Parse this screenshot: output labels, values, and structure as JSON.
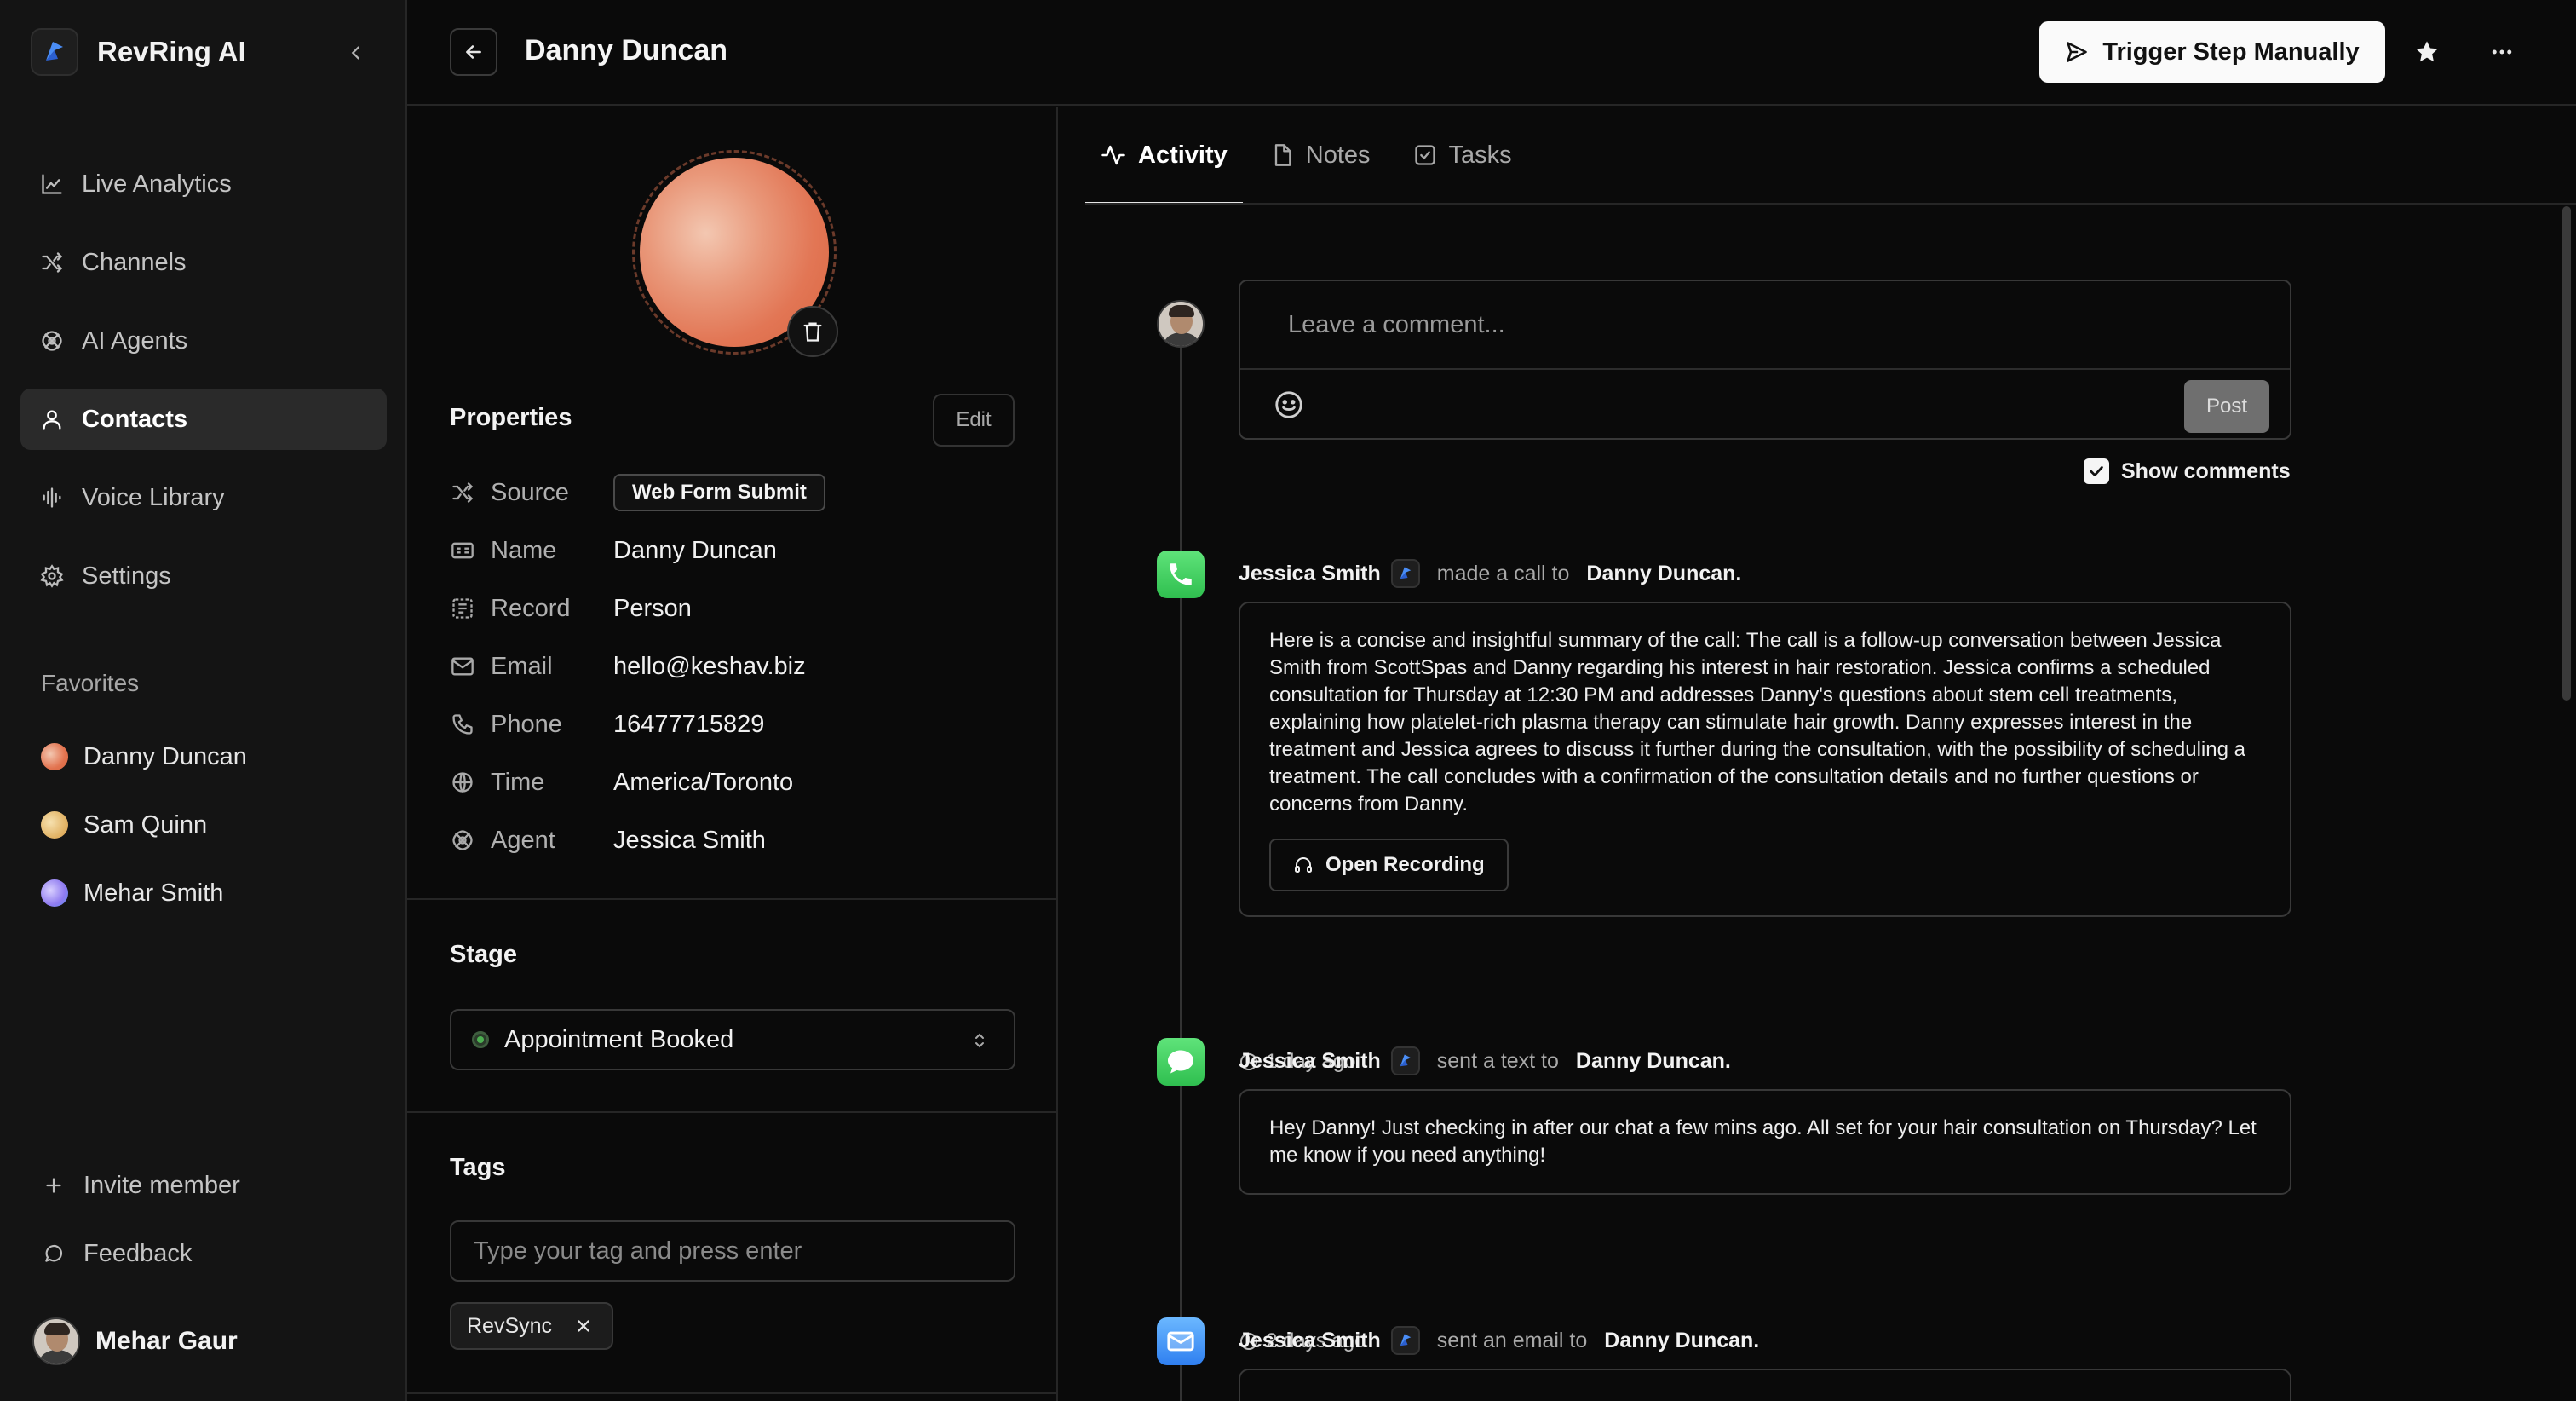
{
  "app": {
    "name": "RevRing AI"
  },
  "sidebar": {
    "nav": [
      {
        "label": "Live Analytics",
        "icon": "chart-icon"
      },
      {
        "label": "Channels",
        "icon": "shuffle-icon"
      },
      {
        "label": "AI Agents",
        "icon": "agent-icon"
      },
      {
        "label": "Contacts",
        "icon": "user-icon",
        "active": true
      },
      {
        "label": "Voice Library",
        "icon": "waveform-icon"
      },
      {
        "label": "Settings",
        "icon": "gear-icon"
      }
    ],
    "favorites_title": "Favorites",
    "favorites": [
      {
        "name": "Danny Duncan",
        "color": "#e2734f"
      },
      {
        "name": "Sam Quinn",
        "color": "#e3b66a"
      },
      {
        "name": "Mehar Smith",
        "color": "#8f7bf0"
      }
    ],
    "invite_label": "Invite member",
    "feedback_label": "Feedback",
    "user_name": "Mehar Gaur"
  },
  "header": {
    "title": "Danny Duncan",
    "trigger_label": "Trigger Step Manually"
  },
  "contact": {
    "properties_title": "Properties",
    "edit_label": "Edit",
    "properties": [
      {
        "label": "Source",
        "value": "Web Form Submit",
        "icon": "shuffle-icon"
      },
      {
        "label": "Name",
        "value": "Danny Duncan",
        "icon": "id-card-icon"
      },
      {
        "label": "Record",
        "value": "Person",
        "icon": "record-icon"
      },
      {
        "label": "Email",
        "value": "hello@keshav.biz",
        "icon": "mail-icon"
      },
      {
        "label": "Phone",
        "value": "16477715829",
        "icon": "phone-icon"
      },
      {
        "label": "Time",
        "value": "America/Toronto",
        "icon": "globe-icon"
      },
      {
        "label": "Agent",
        "value": "Jessica Smith",
        "icon": "agent-icon"
      }
    ],
    "stage_title": "Stage",
    "stage_value": "Appointment Booked",
    "tags_title": "Tags",
    "tag_placeholder": "Type your tag and press enter",
    "tags": [
      "RevSync"
    ]
  },
  "activity": {
    "tabs": [
      {
        "label": "Activity",
        "active": true
      },
      {
        "label": "Notes"
      },
      {
        "label": "Tasks"
      }
    ],
    "comment_placeholder": "Leave a comment...",
    "post_label": "Post",
    "show_comments_label": "Show comments",
    "events": [
      {
        "type": "call",
        "actor": "Jessica Smith",
        "verb": "made a call to",
        "target": "Danny Duncan.",
        "body": "Here is a concise and insightful summary of the call: The call is a follow-up conversation between Jessica Smith from ScottSpas and Danny regarding his interest in hair restoration. Jessica confirms a scheduled consultation for Thursday at 12:30 PM and addresses Danny's questions about stem cell treatments, explaining how platelet-rich plasma therapy can stimulate hair growth. Danny expresses interest in the treatment and Jessica agrees to discuss it further during the consultation, with the possibility of scheduling a treatment. The call concludes with a confirmation of the consultation details and no further questions or concerns from Danny.",
        "button": "Open Recording",
        "time": "1 day ago"
      },
      {
        "type": "text",
        "actor": "Jessica Smith",
        "verb": "sent a text to",
        "target": "Danny Duncan.",
        "body": "Hey Danny! Just checking in after our chat a few mins ago. All set for your hair consultation on Thursday? Let me know if you need anything!",
        "time": "2 days ago"
      },
      {
        "type": "email",
        "actor": "Jessica Smith",
        "verb": "sent an email to",
        "target": "Danny Duncan."
      }
    ]
  }
}
